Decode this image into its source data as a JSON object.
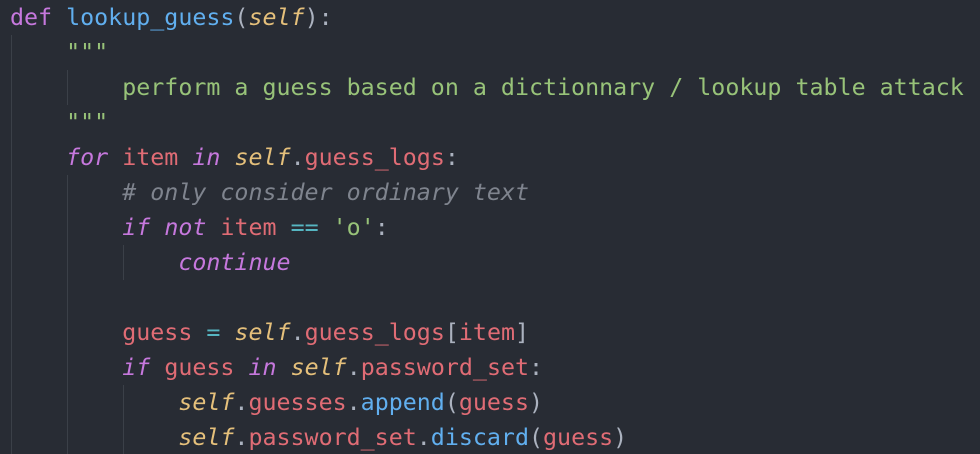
{
  "code": {
    "def_kw": "def",
    "func_name": "lookup_guess",
    "paren_open": "(",
    "self_param": "self",
    "paren_close_colon": "):",
    "docstring_quotes": "\"\"\"",
    "docstring_text": "perform a guess based on a dictionnary / lookup table attack",
    "for_kw": "for",
    "loop_var": "item",
    "in_kw": "in",
    "self_ref": "self",
    "dot": ".",
    "attr_guess_logs": "guess_logs",
    "colon": ":",
    "comment": "# only consider ordinary text",
    "if_kw": "if",
    "not_kw": "not",
    "eq_op": "==",
    "string_o": "'o'",
    "continue_kw": "continue",
    "guess_var": "guess",
    "assign_op": "=",
    "bracket_open": "[",
    "bracket_close": "]",
    "attr_password_set": "password_set",
    "attr_guesses": "guesses",
    "method_append": "append",
    "method_discard": "discard",
    "paren_close": ")"
  },
  "colors": {
    "background": "#282c34",
    "keyword": "#c678dd",
    "function": "#61afef",
    "self": "#e5c07b",
    "attribute": "#e06c75",
    "string": "#98c379",
    "comment": "#7f848e",
    "operator": "#56b6c2",
    "punctuation": "#abb2bf"
  }
}
